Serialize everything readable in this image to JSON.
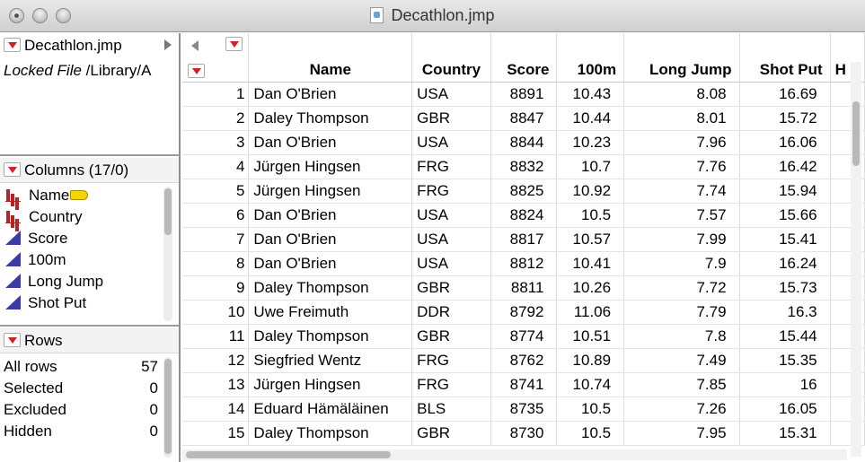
{
  "window": {
    "title": "Decathlon.jmp"
  },
  "file_panel": {
    "name": "Decathlon.jmp",
    "locked_label": "Locked File",
    "path": "/Library/A"
  },
  "columns_panel": {
    "header": "Columns (17/0)",
    "items": [
      {
        "label": "Name",
        "type": "nominal",
        "icon": "bar-chart-icon",
        "tag": "label-tag-icon"
      },
      {
        "label": "Country",
        "type": "nominal",
        "icon": "bar-chart-icon"
      },
      {
        "label": "Score",
        "type": "continuous",
        "icon": "triangle-icon"
      },
      {
        "label": "100m",
        "type": "continuous",
        "icon": "triangle-icon"
      },
      {
        "label": "Long Jump",
        "type": "continuous",
        "icon": "triangle-icon"
      },
      {
        "label": "Shot Put",
        "type": "continuous",
        "icon": "triangle-icon"
      }
    ]
  },
  "rows_panel": {
    "header": "Rows",
    "items": [
      {
        "label": "All rows",
        "value": "57"
      },
      {
        "label": "Selected",
        "value": "0"
      },
      {
        "label": "Excluded",
        "value": "0"
      },
      {
        "label": "Hidden",
        "value": "0"
      }
    ]
  },
  "table": {
    "columns": [
      "Name",
      "Country",
      "Score",
      "100m",
      "Long Jump",
      "Shot Put",
      "H"
    ],
    "rows": [
      [
        "1",
        "Dan O'Brien",
        "USA",
        "8891",
        "10.43",
        "8.08",
        "16.69"
      ],
      [
        "2",
        "Daley Thompson",
        "GBR",
        "8847",
        "10.44",
        "8.01",
        "15.72"
      ],
      [
        "3",
        "Dan O'Brien",
        "USA",
        "8844",
        "10.23",
        "7.96",
        "16.06"
      ],
      [
        "4",
        "Jürgen Hingsen",
        "FRG",
        "8832",
        "10.7",
        "7.76",
        "16.42"
      ],
      [
        "5",
        "Jürgen Hingsen",
        "FRG",
        "8825",
        "10.92",
        "7.74",
        "15.94"
      ],
      [
        "6",
        "Dan O'Brien",
        "USA",
        "8824",
        "10.5",
        "7.57",
        "15.66"
      ],
      [
        "7",
        "Dan O'Brien",
        "USA",
        "8817",
        "10.57",
        "7.99",
        "15.41"
      ],
      [
        "8",
        "Dan O'Brien",
        "USA",
        "8812",
        "10.41",
        "7.9",
        "16.24"
      ],
      [
        "9",
        "Daley Thompson",
        "GBR",
        "8811",
        "10.26",
        "7.72",
        "15.73"
      ],
      [
        "10",
        "Uwe Freimuth",
        "DDR",
        "8792",
        "11.06",
        "7.79",
        "16.3"
      ],
      [
        "11",
        "Daley Thompson",
        "GBR",
        "8774",
        "10.51",
        "7.8",
        "15.44"
      ],
      [
        "12",
        "Siegfried Wentz",
        "FRG",
        "8762",
        "10.89",
        "7.49",
        "15.35"
      ],
      [
        "13",
        "Jürgen Hingsen",
        "FRG",
        "8741",
        "10.74",
        "7.85",
        "16"
      ],
      [
        "14",
        "Eduard Hämäläinen",
        "BLS",
        "8735",
        "10.5",
        "7.26",
        "16.05"
      ],
      [
        "15",
        "Daley Thompson",
        "GBR",
        "8730",
        "10.5",
        "7.95",
        "15.31"
      ]
    ]
  }
}
